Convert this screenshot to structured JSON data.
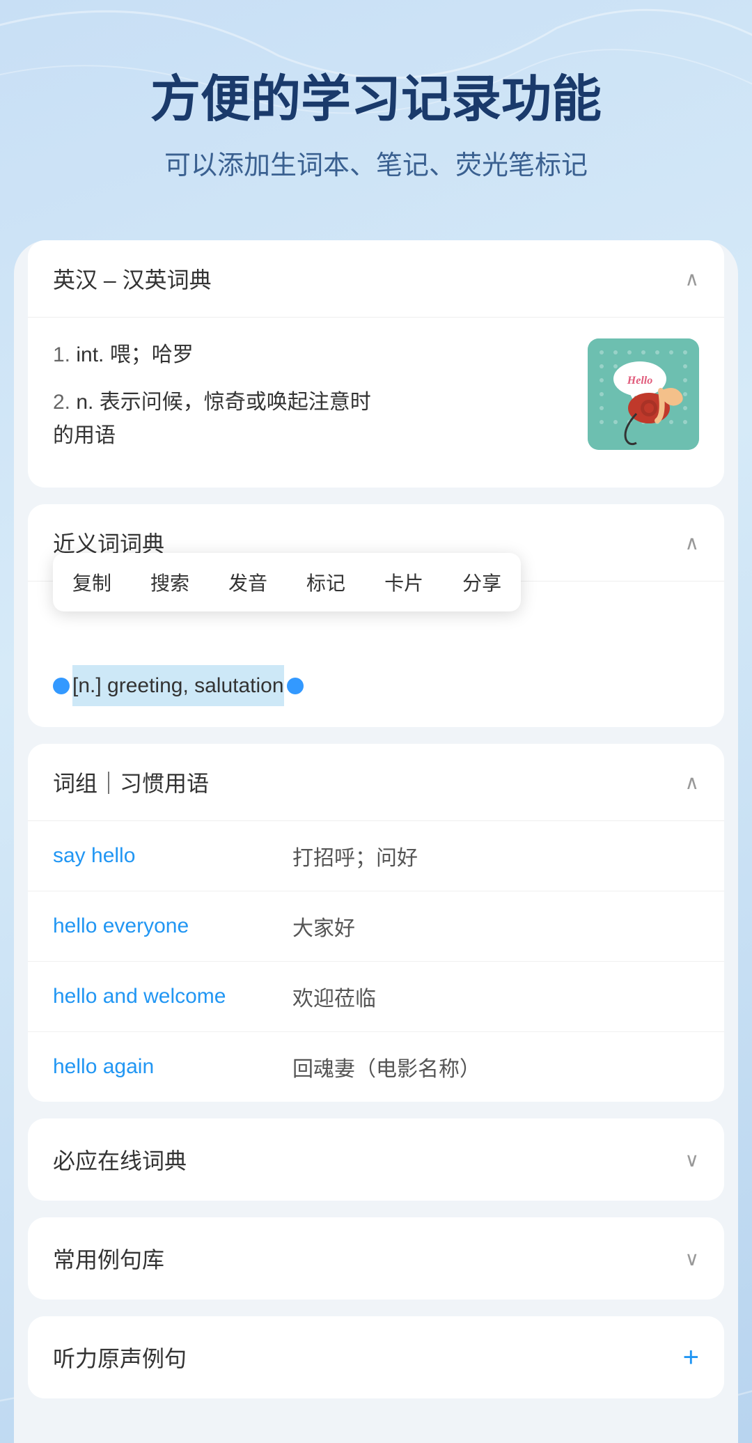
{
  "header": {
    "title": "方便的学习记录功能",
    "subtitle": "可以添加生词本、笔记、荧光笔标记"
  },
  "english_chinese_dict": {
    "section_title": "英汉 – 汉英词典",
    "definitions": [
      {
        "num": "1.",
        "part": "int.",
        "text": "喂；哈罗"
      },
      {
        "num": "2.",
        "part": "n.",
        "text": "表示问候，惊奇或唤起注意时的用语"
      }
    ]
  },
  "synonym_dict": {
    "section_title": "近义词词典",
    "context_menu": {
      "items": [
        "复制",
        "搜索",
        "发音",
        "标记",
        "卡片",
        "分享"
      ]
    },
    "selected_text": "[n.] greeting, salutation"
  },
  "phrases": {
    "section_title": "词组｜习惯用语",
    "items": [
      {
        "en": "say hello",
        "zh": "打招呼；问好"
      },
      {
        "en": "hello everyone",
        "zh": "大家好"
      },
      {
        "en": "hello and welcome",
        "zh": "欢迎莅临"
      },
      {
        "en": "hello again",
        "zh": "回魂妻（电影名称）"
      }
    ]
  },
  "biyingdict": {
    "title": "必应在线词典"
  },
  "example_lib": {
    "title": "常用例句库"
  },
  "audio_examples": {
    "title": "听力原声例句"
  }
}
